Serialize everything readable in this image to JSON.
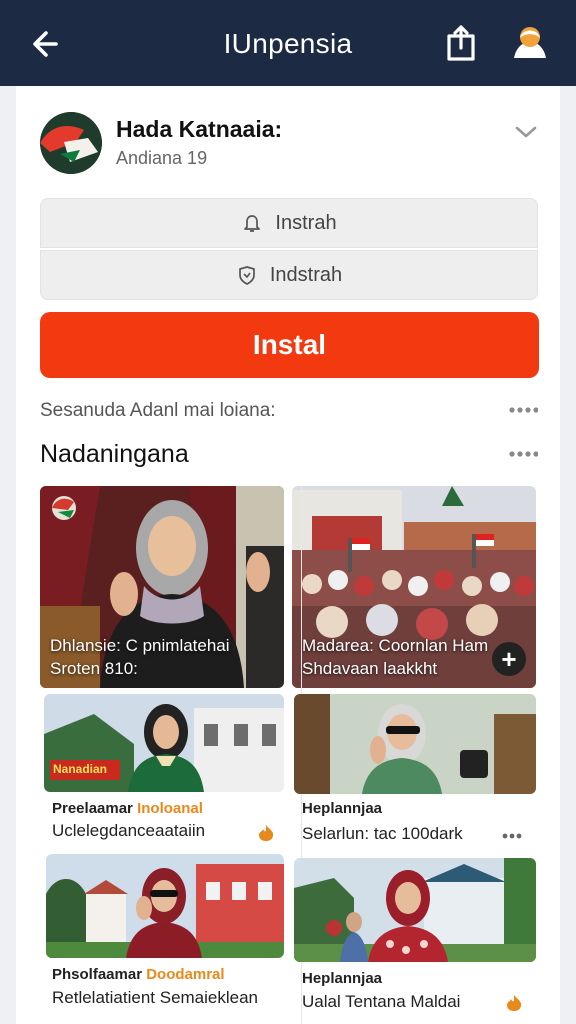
{
  "header": {
    "title": "IUnpensia"
  },
  "app": {
    "name": "Hada Katnaaia:",
    "subtitle": "Andiana 19"
  },
  "options": [
    {
      "label": "Instrah"
    },
    {
      "label": "Indstrah"
    }
  ],
  "install_label": "Instal",
  "info_line": "Sesanuda Adanl mai loiana:",
  "section_title": "Nadaningana",
  "featured": [
    {
      "caption": "Dhlansie: C pnimlatehai",
      "caption2": "Sroten 810:"
    },
    {
      "caption": "Madarea: Coornlan Ham",
      "caption2": "Shdavaan laakkht"
    }
  ],
  "items": [
    {
      "title_a": "Preelaamar ",
      "title_b": "Inoloanal",
      "subtitle": "Uclelegdanceaataiin",
      "badge_text": "Nanadian"
    },
    {
      "title_a": "Heplannjaa",
      "title_b": "",
      "subtitle": "Selarlun: tac 100dark"
    },
    {
      "title_a": "Phsolfaamar ",
      "title_b": "Doodamral",
      "subtitle": "Retlelatiatient Semaieklean"
    },
    {
      "title_a": "Heplannjaa",
      "title_b": "",
      "subtitle": "Ualal Tentana Maldai"
    }
  ],
  "colors": {
    "header_bg": "#1c2a43",
    "accent": "#f2390f",
    "highlight": "#e8891b"
  },
  "icons": [
    "back-arrow-icon",
    "share-icon",
    "profile-icon",
    "chevron-down-icon",
    "bell-icon",
    "shield-icon",
    "more-icon",
    "plus-icon",
    "flame-icon"
  ]
}
